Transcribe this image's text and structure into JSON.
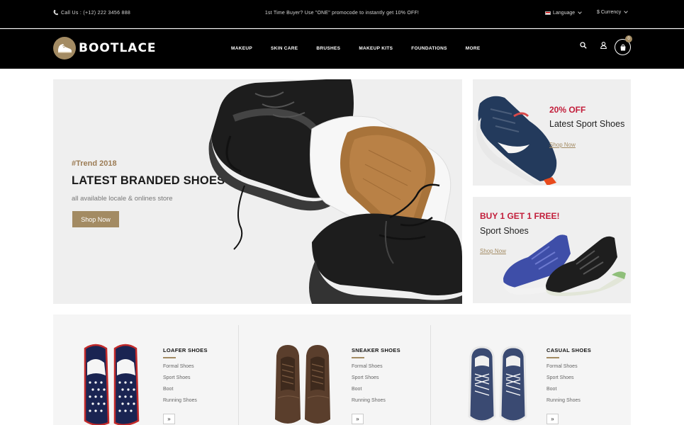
{
  "topbar": {
    "call": "Call Us : (+12) 222 3456 888",
    "promo": "1st Time Buyer? Use \"ONE\" promocode to instantly get 10% OFF!",
    "language": "Language",
    "currency": "$ Currency"
  },
  "header": {
    "brand": "BOOTLACE",
    "nav": [
      "MAKEUP",
      "SKIN CARE",
      "BRUSHES",
      "MAKEUP KITS",
      "FOUNDATIONS",
      "MORE"
    ],
    "cart_count": "0"
  },
  "hero": {
    "tag": "#Trend 2018",
    "title": "LATEST BRANDED SHOES",
    "subtitle": "all available locale & onlines store",
    "button": "Shop Now"
  },
  "side_banners": [
    {
      "offer": "20% OFF",
      "title": "Latest Sport Shoes",
      "link": "Shop Now"
    },
    {
      "offer": "BUY 1 GET 1 FREE!",
      "title": "Sport Shoes",
      "link": "Shop Now"
    }
  ],
  "categories": [
    {
      "title": "LOAFER SHOES",
      "links": [
        "Formal Shoes",
        "Sport Shoes",
        "Boot",
        "Running Shoes"
      ],
      "more": "»"
    },
    {
      "title": "SNEAKER SHOES",
      "links": [
        "Formal Shoes",
        "Sport Shoes",
        "Boot",
        "Running Shoes"
      ],
      "more": "»"
    },
    {
      "title": "CASUAL SHOES",
      "links": [
        "Formal Shoes",
        "Sport Shoes",
        "Boot",
        "Running Shoes"
      ],
      "more": "»"
    }
  ],
  "colors": {
    "accent": "#a38b63",
    "offer_red": "#c21d3a",
    "topbar_bg": "#000000"
  }
}
